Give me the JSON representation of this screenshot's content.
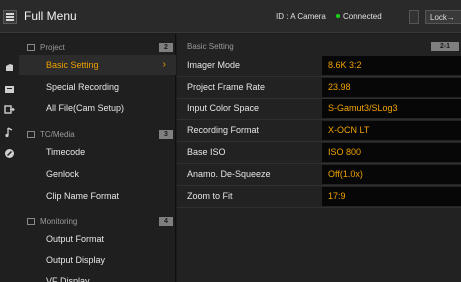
{
  "header": {
    "title": "Full Menu",
    "camera_id": "ID : A Camera",
    "status": "Connected",
    "lock_label": "Lock→"
  },
  "categories": [
    "project-icon",
    "tc-media-icon",
    "monitoring-icon",
    "audio-icon",
    "tools-icon"
  ],
  "left_menu": {
    "sections": [
      {
        "label": "Project",
        "number": "2",
        "icon": "project-icon"
      },
      {
        "label": "TC/Media",
        "number": "3",
        "icon": "tc-media-icon"
      },
      {
        "label": "Monitoring",
        "number": "4",
        "icon": "monitoring-icon"
      }
    ],
    "items": [
      {
        "label": "Basic Setting",
        "active": true
      },
      {
        "label": "Special Recording"
      },
      {
        "label": "All File(Cam Setup)"
      },
      {
        "label": "Timecode"
      },
      {
        "label": "Genlock"
      },
      {
        "label": "Clip Name Format"
      },
      {
        "label": "Output Format"
      },
      {
        "label": "Output Display"
      },
      {
        "label": "VF Display"
      }
    ]
  },
  "settings": {
    "title": "Basic Setting",
    "page": "2-1",
    "rows": [
      {
        "label": "Imager Mode",
        "value": "8.6K 3:2"
      },
      {
        "label": "Project Frame Rate",
        "value": "23.98"
      },
      {
        "label": "Input Color Space",
        "value": "S-Gamut3/SLog3"
      },
      {
        "label": "Recording Format",
        "value": "X-OCN LT"
      },
      {
        "label": "Base ISO",
        "value": "ISO 800"
      },
      {
        "label": "Anamo. De-Squeeze",
        "value": "Off(1.0x)"
      },
      {
        "label": "Zoom to Fit",
        "value": "17:9"
      }
    ]
  },
  "colors": {
    "accent": "#f0a000",
    "connected": "#19d619"
  }
}
